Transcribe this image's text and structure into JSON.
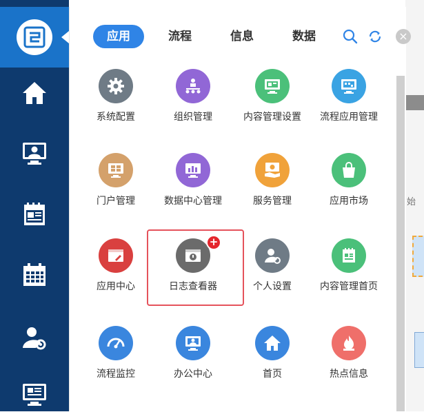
{
  "sidebar": {
    "icons": [
      "logo-icon",
      "home-icon",
      "monitor-user-icon",
      "calendar-news-icon",
      "calendar-grid-icon",
      "user-settings-icon",
      "monitor-doc-icon"
    ]
  },
  "tabs": [
    {
      "label": "应用",
      "active": true
    },
    {
      "label": "流程",
      "active": false
    },
    {
      "label": "信息",
      "active": false
    },
    {
      "label": "数据",
      "active": false
    }
  ],
  "apps": [
    {
      "label": "系统配置",
      "color": "#6f7b86",
      "icon": "gear-icon"
    },
    {
      "label": "组织管理",
      "color": "#9167d6",
      "icon": "org-chart-icon"
    },
    {
      "label": "内容管理设置",
      "color": "#4bc07a",
      "icon": "content-settings-icon"
    },
    {
      "label": "流程应用管理",
      "color": "#3aa3e3",
      "icon": "flow-app-icon"
    },
    {
      "label": "门户管理",
      "color": "#d4a16b",
      "icon": "portal-grid-icon"
    },
    {
      "label": "数据中心管理",
      "color": "#9167d6",
      "icon": "data-chart-icon"
    },
    {
      "label": "服务管理",
      "color": "#f0a23a",
      "icon": "service-icon"
    },
    {
      "label": "应用市场",
      "color": "#4bc07a",
      "icon": "shopping-bag-icon"
    },
    {
      "label": "应用中心",
      "color": "#d9403f",
      "icon": "app-center-icon"
    },
    {
      "label": "日志查看器",
      "color": "#6b6b6b",
      "icon": "log-viewer-icon",
      "badge": "+"
    },
    {
      "label": "个人设置",
      "color": "#6f7b86",
      "icon": "user-gear-icon"
    },
    {
      "label": "内容管理首页",
      "color": "#4bc07a",
      "icon": "content-home-icon"
    },
    {
      "label": "流程监控",
      "color": "#3a86de",
      "icon": "speedometer-icon"
    },
    {
      "label": "办公中心",
      "color": "#3a86de",
      "icon": "office-monitor-icon"
    },
    {
      "label": "首页",
      "color": "#3a86de",
      "icon": "home-icon"
    },
    {
      "label": "热点信息",
      "color": "#ef6f6a",
      "icon": "flame-icon"
    }
  ],
  "background_window": {
    "partial_text": "始"
  },
  "close_label": "×"
}
